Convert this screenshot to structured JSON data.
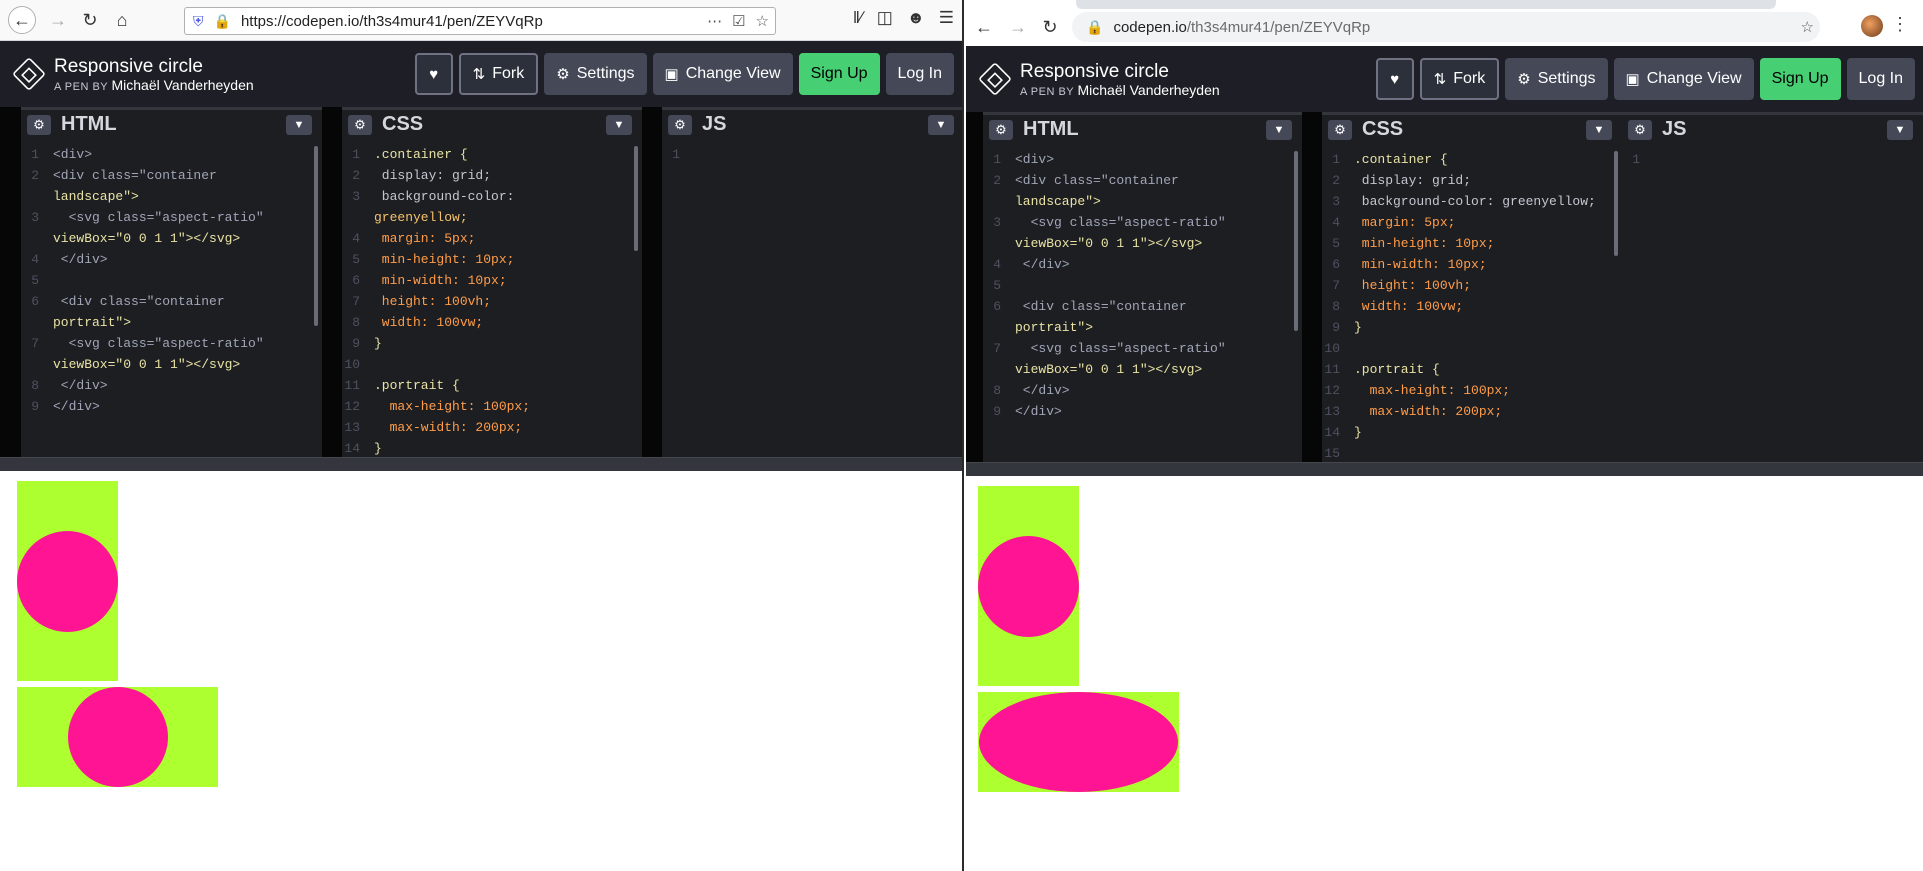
{
  "left_browser": {
    "url_host": "https://codepen.io",
    "url_path": "/th3s4mur41/pen/ZEYVqRp"
  },
  "right_browser": {
    "url_host": "codepen.io",
    "url_path": "/th3s4mur41/pen/ZEYVqRp"
  },
  "pen": {
    "title": "Responsive circle",
    "by_label": "A PEN BY",
    "author": "Michaël Vanderheyden"
  },
  "toolbar": {
    "fork": "Fork",
    "settings": "Settings",
    "change_view": "Change View",
    "sign_up": "Sign Up",
    "log_in": "Log In"
  },
  "editors": {
    "html": "HTML",
    "css": "CSS",
    "js": "JS"
  },
  "html_code_wrapped": [
    {
      "n": "1",
      "t": "<div>"
    },
    {
      "n": "2",
      "t": "<div class=\"container"
    },
    {
      "n": "",
      "t": "landscape\">"
    },
    {
      "n": "3",
      "t": "  <svg class=\"aspect-ratio\""
    },
    {
      "n": "",
      "t": "viewBox=\"0 0 1 1\"></svg>"
    },
    {
      "n": "4",
      "t": " </div>"
    },
    {
      "n": "5",
      "t": ""
    },
    {
      "n": "6",
      "t": " <div class=\"container"
    },
    {
      "n": "",
      "t": "portrait\">"
    },
    {
      "n": "7",
      "t": "  <svg class=\"aspect-ratio\""
    },
    {
      "n": "",
      "t": "viewBox=\"0 0 1 1\"></svg>"
    },
    {
      "n": "8",
      "t": " </div>"
    },
    {
      "n": "9",
      "t": "</div>"
    }
  ],
  "css_code_left": [
    {
      "n": "1",
      "t": ".container {"
    },
    {
      "n": "2",
      "t": " display: grid;"
    },
    {
      "n": "3",
      "t": " background-color:"
    },
    {
      "n": "",
      "t": "greenyellow;"
    },
    {
      "n": "4",
      "t": " margin: 5px;"
    },
    {
      "n": "5",
      "t": " min-height: 10px;"
    },
    {
      "n": "6",
      "t": " min-width: 10px;"
    },
    {
      "n": "7",
      "t": " height: 100vh;"
    },
    {
      "n": "8",
      "t": " width: 100vw;"
    },
    {
      "n": "9",
      "t": "}"
    },
    {
      "n": "10",
      "t": ""
    },
    {
      "n": "11",
      "t": ".portrait {"
    },
    {
      "n": "12",
      "t": "  max-height: 100px;"
    },
    {
      "n": "13",
      "t": "  max-width: 200px;"
    },
    {
      "n": "14",
      "t": "}"
    }
  ],
  "css_code_right": [
    {
      "n": "1",
      "t": ".container {"
    },
    {
      "n": "2",
      "t": " display: grid;"
    },
    {
      "n": "3",
      "t": " background-color: greenyellow;"
    },
    {
      "n": "4",
      "t": " margin: 5px;"
    },
    {
      "n": "5",
      "t": " min-height: 10px;"
    },
    {
      "n": "6",
      "t": " min-width: 10px;"
    },
    {
      "n": "7",
      "t": " height: 100vh;"
    },
    {
      "n": "8",
      "t": " width: 100vw;"
    },
    {
      "n": "9",
      "t": "}"
    },
    {
      "n": "10",
      "t": ""
    },
    {
      "n": "11",
      "t": ".portrait {"
    },
    {
      "n": "12",
      "t": "  max-height: 100px;"
    },
    {
      "n": "13",
      "t": "  max-width: 200px;"
    },
    {
      "n": "14",
      "t": "}"
    },
    {
      "n": "15",
      "t": ""
    }
  ],
  "js_code": [
    {
      "n": "1",
      "t": ""
    }
  ],
  "colors": {
    "container_bg": "#adff2f",
    "circle": "#ff1493",
    "codepen_header": "#1e1f26",
    "sign_up": "#47cf73"
  }
}
